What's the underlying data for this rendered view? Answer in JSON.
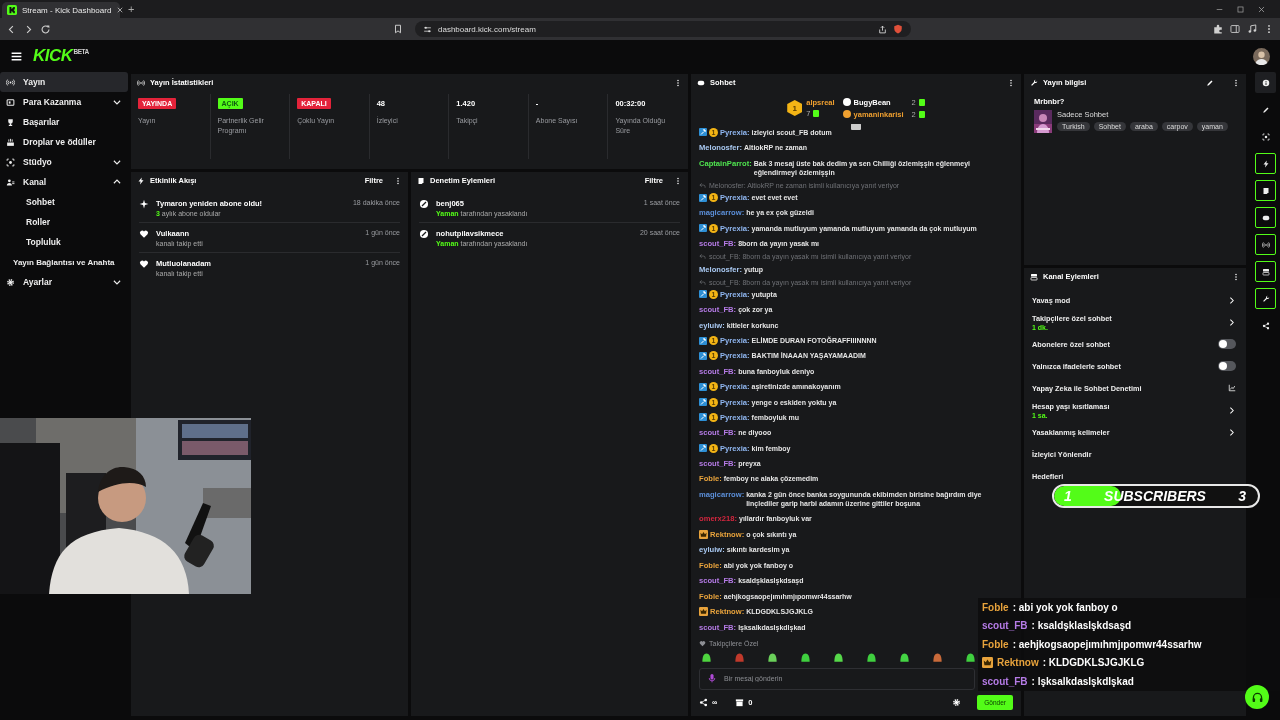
{
  "browser": {
    "tab_title": "Stream - Kick Dashboard",
    "new_tab": "+",
    "url": "dashboard.kick.com/stream"
  },
  "header": {
    "logo": "KICK",
    "logo_tag": "BETA"
  },
  "sidebar": {
    "items": [
      {
        "label": "Yayın",
        "selected": true
      },
      {
        "label": "Para Kazanma",
        "selected": false,
        "expanded": false
      },
      {
        "label": "Başarılar",
        "selected": false
      },
      {
        "label": "Droplar ve ödüller",
        "selected": false
      },
      {
        "label": "Stüdyo",
        "selected": false,
        "expanded": false
      },
      {
        "label": "Kanal",
        "selected": false,
        "expanded": true,
        "children": [
          {
            "label": "Sohbet",
            "selected": false
          },
          {
            "label": "Roller",
            "selected": false
          },
          {
            "label": "Topluluk",
            "selected": false
          },
          {
            "label": "Yayın Bağlantısı ve Anahta",
            "selected": false
          }
        ]
      },
      {
        "label": "Ayarlar",
        "selected": false,
        "expanded": false
      }
    ]
  },
  "stats": {
    "title": "Yayın İstatistikleri",
    "cells": [
      {
        "kind": "badge",
        "value": "YAYINDA",
        "color": "#e3233a",
        "label": "Yayın"
      },
      {
        "kind": "badge",
        "value": "AÇIK",
        "color": "#53fc18",
        "label": "Partnerlik Gelir Programı"
      },
      {
        "kind": "badge",
        "value": "KAPALI",
        "color": "#e3233a",
        "label": "Çoklu Yayın"
      },
      {
        "kind": "number",
        "value": "48",
        "label": "İzleyici"
      },
      {
        "kind": "number",
        "value": "1.420",
        "label": "Takipçi"
      },
      {
        "kind": "number",
        "value": "-",
        "label": "Abone Sayısı"
      },
      {
        "kind": "number",
        "value": "00:32:00",
        "label": "Yayında Olduğu Süre"
      }
    ]
  },
  "events": {
    "title": "Etkinlik Akışı",
    "filter": "Filtre",
    "items": [
      {
        "kind": "resub",
        "title": "Tymaron yeniden abone oldu!",
        "highlight": "3",
        "detail": "aylık abone oldular",
        "time": "18 dakika önce"
      },
      {
        "kind": "follow",
        "title": "Vulkaann",
        "detail": "kanalı takip etti",
        "time": "1 gün önce"
      },
      {
        "kind": "follow",
        "title": "Mutluolanadam",
        "detail": "kanalı takip etti",
        "time": "1 gün önce"
      }
    ]
  },
  "moderation": {
    "title": "Denetim Eylemleri",
    "filter": "Filtre",
    "items": [
      {
        "kind": "ban",
        "title": "benj065",
        "highlight": "Yaman",
        "detail": "tarafından yasaklandı",
        "time": "1 saat önce"
      },
      {
        "kind": "ban",
        "title": "nohutpilavsikmece",
        "highlight": "Yaman",
        "detail": "tarafından yasaklandı",
        "time": "20 saat önce"
      }
    ]
  },
  "chat": {
    "title": "Sohbet",
    "leaderboard": {
      "rank": "1",
      "top": {
        "name": "alpsreal",
        "count": "7",
        "color": "#f0a030"
      },
      "others": [
        {
          "name": "BugyBean",
          "count": "2",
          "color": "#ffffff"
        },
        {
          "name": "yamaninkarisi",
          "count": "2",
          "color": "#f0a030"
        }
      ]
    },
    "messages": [
      {
        "kind": "moderator",
        "sub_badge": "1",
        "user": "Pyrexia:",
        "color": "#8fb6f0",
        "text": "izleyici scout_FB dotum"
      },
      {
        "kind": "plain",
        "user": "Melonosfer:",
        "color": "#a9c9f2",
        "text": "AltiokRP ne zaman"
      },
      {
        "kind": "plain",
        "user": "CaptainParrot:",
        "color": "#4fe34f",
        "text": "Bak 3 mesaj üste bak dedim ya sen Chilliği özlemişşin eğlenmeyi eğlendirmeyi özlemişşin"
      },
      {
        "kind": "reply",
        "text": "Melonosfer: AltiokRP ne zaman isimli kullanıcıya yanıt veriyor"
      },
      {
        "kind": "moderator",
        "sub_badge": "1",
        "user": "Pyrexia:",
        "color": "#8fb6f0",
        "text": "evet evet evet"
      },
      {
        "kind": "plain",
        "user": "magicarrow:",
        "color": "#5b8fd9",
        "text": "he ya ex çok güzeldi"
      },
      {
        "kind": "moderator",
        "sub_badge": "1",
        "user": "Pyrexia:",
        "color": "#8fb6f0",
        "text": "yamanda mutluyum yamanda mutluyum yamanda da çok mutluyum"
      },
      {
        "kind": "plain",
        "user": "scout_FB:",
        "color": "#b57be6",
        "text": "8born da yayın yasak mı"
      },
      {
        "kind": "reply",
        "text": "scout_FB: 8born da yayın yasak mı isimli kullanıcıya yanıt veriyor"
      },
      {
        "kind": "plain",
        "user": "Melonosfer:",
        "color": "#a9c9f2",
        "text": "yutup"
      },
      {
        "kind": "reply",
        "text": "scout_FB: 8born da yayın yasak mı isimli kullanıcıya yanıt veriyor"
      },
      {
        "kind": "moderator",
        "sub_badge": "1",
        "user": "Pyrexia:",
        "color": "#8fb6f0",
        "text": "yutupta"
      },
      {
        "kind": "plain",
        "user": "scout_FB:",
        "color": "#b57be6",
        "text": "çok zor ya"
      },
      {
        "kind": "plain",
        "user": "eyluiw:",
        "color": "#a9c9f2",
        "text": "kitleler korkunc"
      },
      {
        "kind": "moderator",
        "sub_badge": "1",
        "user": "Pyrexia:",
        "color": "#8fb6f0",
        "text": "ELİMDE DURAN FOTOĞRAFFIIINNNN"
      },
      {
        "kind": "moderator",
        "sub_badge": "1",
        "user": "Pyrexia:",
        "color": "#8fb6f0",
        "text": "BAKTIM İNAAAN YAŞAYAMAADIM"
      },
      {
        "kind": "plain",
        "user": "scout_FB:",
        "color": "#b57be6",
        "text": "buna fanboyluk deniyo"
      },
      {
        "kind": "moderator",
        "sub_badge": "1",
        "user": "Pyrexia:",
        "color": "#8fb6f0",
        "text": "aşiretinizde amınakoyanım"
      },
      {
        "kind": "moderator",
        "sub_badge": "1",
        "user": "Pyrexia:",
        "color": "#8fb6f0",
        "text": "yenge o eskiden yoktu ya"
      },
      {
        "kind": "moderator",
        "sub_badge": "1",
        "user": "Pyrexia:",
        "color": "#8fb6f0",
        "text": "femboyluk mu"
      },
      {
        "kind": "plain",
        "user": "scout_FB:",
        "color": "#b57be6",
        "text": "ne diyooo"
      },
      {
        "kind": "moderator",
        "sub_badge": "1",
        "user": "Pyrexia:",
        "color": "#8fb6f0",
        "text": "kim femboy"
      },
      {
        "kind": "plain",
        "user": "scout_FB:",
        "color": "#b57be6",
        "text": "preyxa"
      },
      {
        "kind": "plain",
        "user": "Foble:",
        "color": "#e8a33c",
        "text": "femboy ne alaka çözemedim"
      },
      {
        "kind": "plain",
        "user": "magicarrow:",
        "color": "#5b8fd9",
        "text": "kanka 2 gün önce banka soygununda ekibimden birisine bağırdım diye linçlediler garip harbi adamın üzerine gittiler boşuna"
      },
      {
        "kind": "plain",
        "user": "omerx218:",
        "color": "#d0263e",
        "text": "yıllardır fanboyluk var"
      },
      {
        "kind": "crown",
        "user": "Rektnow:",
        "color": "#e8a33c",
        "text": "o çok sıkıntı ya"
      },
      {
        "kind": "plain",
        "user": "eyluiw:",
        "color": "#a9c9f2",
        "text": "sıkıntı kardesim ya"
      },
      {
        "kind": "plain",
        "user": "Foble:",
        "color": "#e8a33c",
        "text": "abi yok yok fanboy o"
      },
      {
        "kind": "plain",
        "user": "scout_FB:",
        "color": "#b57be6",
        "text": "ksaldşklaslşkdsaşd"
      },
      {
        "kind": "plain",
        "user": "Foble:",
        "color": "#e8a33c",
        "text": "aehjkogsaopejımıhmjıpomwr44ssarhw"
      },
      {
        "kind": "crown",
        "user": "Rektnow:",
        "color": "#e8a33c",
        "text": "KLDGDKLSJGJKLG"
      },
      {
        "kind": "plain",
        "user": "scout_FB:",
        "color": "#b57be6",
        "text": "lşksalkdaslşkdlşkad"
      }
    ],
    "mode_label": "Takipçilere Özel",
    "placeholder": "Bir mesaj gönderin",
    "points": "∞",
    "store_count": "0",
    "send": "Gönder"
  },
  "stream_info": {
    "title": "Yayın bilgisi",
    "stream_title": "Mrbnbr?",
    "category": "Sadece Sohbet",
    "tags": [
      "Turkish",
      "Sohbet",
      "araba",
      "carpov",
      "yaman"
    ]
  },
  "channel_actions": {
    "title": "Kanal Eylemleri",
    "items": [
      {
        "kind": "link",
        "label": "Yavaş mod"
      },
      {
        "kind": "link",
        "label": "Takipçilere özel sohbet",
        "value": "1 dk."
      },
      {
        "kind": "toggle",
        "label": "Abonelere özel sohbet",
        "on": false
      },
      {
        "kind": "toggle",
        "label": "Yalnızca ifadelerle sohbet",
        "on": false
      },
      {
        "kind": "external",
        "label": "Yapay Zeka ile Sohbet Denetimi"
      },
      {
        "kind": "link",
        "label": "Hesap yaşı kısıtlaması",
        "value": "1 sa."
      },
      {
        "kind": "link",
        "label": "Yasaklanmış kelimeler"
      },
      {
        "kind": "plain",
        "label": "İzleyici Yönlendir"
      },
      {
        "kind": "plain",
        "label": "Hedefleri"
      }
    ]
  },
  "rail": {
    "items": [
      {
        "on": false
      },
      {
        "on": false
      },
      {
        "on": false
      },
      {
        "on": true
      },
      {
        "on": true
      },
      {
        "on": true
      },
      {
        "on": true
      },
      {
        "on": true
      },
      {
        "on": true
      },
      {
        "on": false
      }
    ]
  },
  "goal": {
    "current": "1",
    "label": "SUBSCRIBERS",
    "target": "3",
    "level": 0.33
  },
  "chat_overlay": [
    {
      "kind": "plain",
      "user": "Foble",
      "color": "#e8a33c",
      "text": ": abi yok yok fanboy o"
    },
    {
      "kind": "plain",
      "user": "scout_FB",
      "color": "#b57be6",
      "text": ": ksaldşklaslşkdsaşd"
    },
    {
      "kind": "plain",
      "user": "Foble",
      "color": "#e8a33c",
      "text": ": aehjkogsaopejımıhmjıpomwr44ssarhw"
    },
    {
      "kind": "crown",
      "user": "Rektnow",
      "color": "#e8a33c",
      "text": ": KLDGDKLSJGJKLG"
    },
    {
      "kind": "plain",
      "user": "scout_FB",
      "color": "#b57be6",
      "text": ": lşksalkdaslşkdlşkad"
    }
  ]
}
